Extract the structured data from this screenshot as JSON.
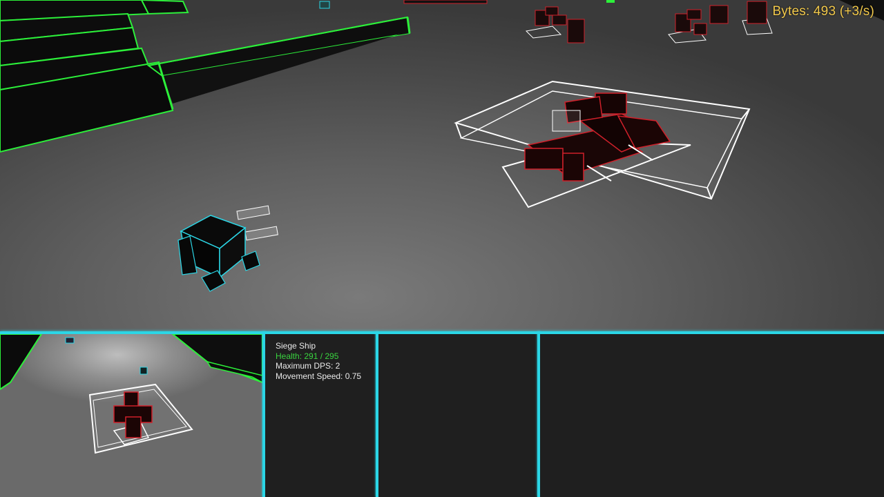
{
  "hud": {
    "resource": {
      "label": "Bytes",
      "amount": "493",
      "rate": "+3/s",
      "text": "Bytes: 493 (+3/s)"
    },
    "selected_unit": {
      "name": "Siege Ship",
      "health": "Health: 291 / 295",
      "max_dps": "Maximum DPS: 2",
      "movement_speed": "Movement Speed: 0.75"
    }
  },
  "colors": {
    "accent": "#2bd6e6",
    "resource_text": "#f2c94c",
    "health_text": "#39d33f",
    "enemy_outline": "#d0202a",
    "wall_outline": "#2cf03a",
    "selection": "#ffffff"
  }
}
